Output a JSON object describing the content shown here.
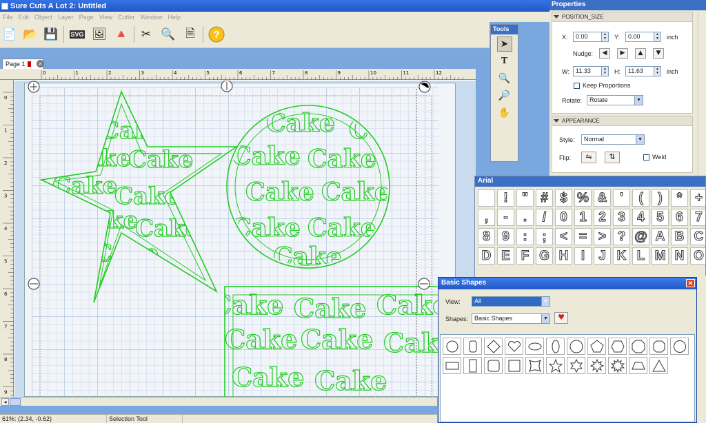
{
  "app": {
    "title": "Sure Cuts A Lot 2: Untitled"
  },
  "menu": [
    "File",
    "Edit",
    "Object",
    "Layer",
    "Page",
    "View",
    "Cutter",
    "Window",
    "Help"
  ],
  "toolbar": {
    "svg_label": "SVG"
  },
  "document": {
    "tab_label": "Page 1"
  },
  "ruler": {
    "h_ticks": [
      "0",
      "1",
      "2",
      "3",
      "4",
      "5",
      "6",
      "7",
      "8",
      "9",
      "10",
      "11",
      "12"
    ],
    "v_ticks": [
      "0",
      "1",
      "2",
      "3",
      "4",
      "5",
      "6",
      "7",
      "8",
      "9"
    ]
  },
  "canvas": {
    "word": "Cake",
    "shape_color": "#22cc22"
  },
  "status": {
    "zoom": "61%: (2.34, -0.62)",
    "tool": "Selection Tool"
  },
  "tools_panel": {
    "title": "Tools"
  },
  "properties": {
    "title": "Properties",
    "position_size": {
      "header": "POSITION_SIZE",
      "x_label": "X:",
      "x_value": "0.00",
      "y_label": "Y:",
      "y_value": "0.00",
      "unit": "inch",
      "nudge_label": "Nudge:",
      "w_label": "W:",
      "w_value": "11.33",
      "h_label": "H:",
      "h_value": "11.63",
      "keep_proportions": "Keep Proportions",
      "rotate_label": "Rotate:",
      "rotate_value": "Rotate"
    },
    "appearance": {
      "header": "APPEARANCE",
      "style_label": "Style:",
      "style_value": "Normal",
      "flip_label": "Flip:",
      "weld_label": "Weld"
    }
  },
  "arial_panel": {
    "title": "Arial",
    "glyphs": [
      "",
      "!",
      "\"",
      "#",
      "$",
      "%",
      "&",
      "'",
      "(",
      ")",
      "*",
      "+",
      ",",
      "-",
      ".",
      "/",
      "0",
      "1",
      "2",
      "3",
      "4",
      "5",
      "6",
      "7",
      "8",
      "9",
      ":",
      ";",
      "<",
      "=",
      ">",
      "?",
      "@",
      "A",
      "B",
      "C",
      "D",
      "E",
      "F",
      "G",
      "H",
      "I",
      "J",
      "K",
      "L",
      "M",
      "N",
      "O"
    ]
  },
  "basic_shapes": {
    "title": "Basic Shapes",
    "view_label": "View:",
    "view_value": "All",
    "shapes_label": "Shapes:",
    "shapes_value": "Basic Shapes",
    "shapes": [
      "circle",
      "rounded-rect-tall",
      "diamond",
      "heart",
      "ellipse",
      "oval-tall",
      "circle-large",
      "pentagon",
      "hexagon",
      "octagon",
      "rounded-octagon",
      "circle-small",
      "rectangle-wide",
      "rectangle-tall",
      "rounded-square",
      "square",
      "concave-square",
      "star-5",
      "star-6",
      "star-8",
      "star-burst",
      "trapezoid",
      "triangle"
    ]
  }
}
